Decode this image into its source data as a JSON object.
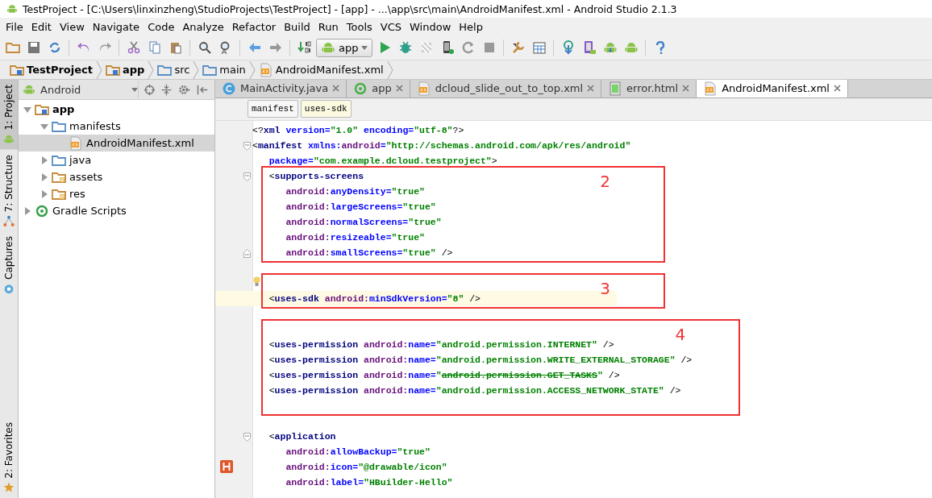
{
  "window": {
    "title": "TestProject - [C:\\Users\\linxinzheng\\StudioProjects\\TestProject] - [app] - ...\\app\\src\\main\\AndroidManifest.xml - Android Studio 2.1.3"
  },
  "menu": [
    "File",
    "Edit",
    "View",
    "Navigate",
    "Code",
    "Analyze",
    "Refactor",
    "Build",
    "Run",
    "Tools",
    "VCS",
    "Window",
    "Help"
  ],
  "toolbar": {
    "run_configuration": "app"
  },
  "nav_bar": [
    {
      "label": "TestProject",
      "kind": "project"
    },
    {
      "label": "app",
      "kind": "module"
    },
    {
      "label": "src",
      "kind": "folder"
    },
    {
      "label": "main",
      "kind": "folder"
    },
    {
      "label": "AndroidManifest.xml",
      "kind": "xml"
    }
  ],
  "side_tabs": [
    {
      "label": "1: Project",
      "kind": "android",
      "selected": true
    },
    {
      "label": "7: Structure",
      "kind": "structure",
      "selected": false
    },
    {
      "label": "Captures",
      "kind": "captures",
      "selected": false
    },
    {
      "label": "2: Favorites",
      "kind": "star",
      "selected": false
    }
  ],
  "project_panel": {
    "view_selector": "Android",
    "tree": [
      {
        "label": "app",
        "kind": "module",
        "expanded": true,
        "selected": false,
        "children": [
          {
            "label": "manifests",
            "kind": "folder",
            "expanded": true,
            "selected": false,
            "children": [
              {
                "label": "AndroidManifest.xml",
                "kind": "xml",
                "selected": true
              }
            ]
          },
          {
            "label": "java",
            "kind": "folder",
            "expanded": false,
            "selected": false
          },
          {
            "label": "assets",
            "kind": "resfolder",
            "expanded": false,
            "selected": false
          },
          {
            "label": "res",
            "kind": "resfolder",
            "expanded": false,
            "selected": false
          }
        ]
      },
      {
        "label": "Gradle Scripts",
        "kind": "gradle",
        "expanded": false,
        "selected": false
      }
    ]
  },
  "editor_tabs": [
    {
      "label": "MainActivity.java",
      "kind": "java",
      "selected": false
    },
    {
      "label": "app",
      "kind": "config",
      "selected": false
    },
    {
      "label": "dcloud_slide_out_to_top.xml",
      "kind": "xml",
      "selected": false
    },
    {
      "label": "error.html",
      "kind": "html",
      "selected": false
    },
    {
      "label": "AndroidManifest.xml",
      "kind": "xml",
      "selected": true
    }
  ],
  "breadcrumb_tags": [
    {
      "label": "manifest",
      "selected": false
    },
    {
      "label": "uses-sdk",
      "selected": true
    }
  ],
  "code_blocks": [
    {
      "lines": [
        {
          "current": false,
          "tokens": [
            {
              "text": "<?",
              "kind": "punct"
            },
            {
              "text": "xml",
              "kind": "tag"
            },
            {
              "text": " version=",
              "kind": "attr"
            },
            {
              "text": "\"1.0\"",
              "kind": "value"
            },
            {
              "text": " encoding=",
              "kind": "attr"
            },
            {
              "text": "\"utf-8\"",
              "kind": "value"
            },
            {
              "text": "?>",
              "kind": "punct"
            }
          ]
        },
        {
          "current": false,
          "gutter": {
            "kind": "fold-start"
          },
          "tokens": [
            {
              "text": "<",
              "kind": "punct"
            },
            {
              "text": "manifest",
              "kind": "tag"
            },
            {
              "text": " xmlns:",
              "kind": "attr"
            },
            {
              "text": "android",
              "kind": "ns"
            },
            {
              "text": "=",
              "kind": "attr"
            },
            {
              "text": "\"http://schemas.android.com/apk/res/android\"",
              "kind": "value"
            }
          ]
        },
        {
          "current": false,
          "tokens": [
            {
              "text": "   package=",
              "kind": "attr"
            },
            {
              "text": "\"com.example.dcloud.testproject\"",
              "kind": "value"
            },
            {
              "text": ">",
              "kind": "punct"
            }
          ]
        }
      ]
    },
    {
      "annotation": "2",
      "lines": [
        {
          "current": false,
          "gutter": {
            "kind": "fold-start"
          },
          "tokens": [
            {
              "text": "   <",
              "kind": "punct"
            },
            {
              "text": "supports-screens",
              "kind": "tag"
            }
          ]
        },
        {
          "current": false,
          "tokens": [
            {
              "text": "      android:",
              "kind": "ns"
            },
            {
              "text": "anyDensity=",
              "kind": "attr"
            },
            {
              "text": "\"true\"",
              "kind": "value"
            }
          ]
        },
        {
          "current": false,
          "tokens": [
            {
              "text": "      android:",
              "kind": "ns"
            },
            {
              "text": "largeScreens=",
              "kind": "attr"
            },
            {
              "text": "\"true\"",
              "kind": "value"
            }
          ]
        },
        {
          "current": false,
          "tokens": [
            {
              "text": "      android:",
              "kind": "ns"
            },
            {
              "text": "normalScreens=",
              "kind": "attr"
            },
            {
              "text": "\"true\"",
              "kind": "value"
            }
          ]
        },
        {
          "current": false,
          "tokens": [
            {
              "text": "      android:",
              "kind": "ns"
            },
            {
              "text": "resizeable=",
              "kind": "attr"
            },
            {
              "text": "\"true\"",
              "kind": "value"
            }
          ]
        },
        {
          "current": false,
          "gutter": {
            "kind": "fold-end"
          },
          "tokens": [
            {
              "text": "      android:",
              "kind": "ns"
            },
            {
              "text": "smallScreens=",
              "kind": "attr"
            },
            {
              "text": "\"true\"",
              "kind": "value"
            },
            {
              "text": " />",
              "kind": "punct"
            }
          ]
        }
      ]
    },
    {
      "lines": [
        {
          "current": false
        }
      ]
    },
    {
      "annotation": "3",
      "lines": [
        {
          "current": false,
          "gutter": {
            "kind": "bulb"
          }
        },
        {
          "current": true,
          "tokens": [
            {
              "text": "   <",
              "kind": "punct"
            },
            {
              "text": "uses-sdk",
              "kind": "tag"
            },
            {
              "text": " android:",
              "kind": "ns"
            },
            {
              "text": "minSdkVersion=",
              "kind": "attr"
            },
            {
              "text": "\"8\"",
              "kind": "value"
            },
            {
              "text": " />",
              "kind": "punct"
            }
          ]
        }
      ]
    },
    {
      "lines": [
        {
          "current": false
        }
      ]
    },
    {
      "annotation": "4",
      "lines": [
        {
          "current": false
        },
        {
          "current": false,
          "tokens": [
            {
              "text": "   <",
              "kind": "punct"
            },
            {
              "text": "uses-permission",
              "kind": "tag"
            },
            {
              "text": " android:",
              "kind": "ns"
            },
            {
              "text": "name=",
              "kind": "attr"
            },
            {
              "text": "\"android.permission.INTERNET\"",
              "kind": "value"
            },
            {
              "text": " />",
              "kind": "punct"
            }
          ]
        },
        {
          "current": false,
          "tokens": [
            {
              "text": "   <",
              "kind": "punct"
            },
            {
              "text": "uses-permission",
              "kind": "tag"
            },
            {
              "text": " android:",
              "kind": "ns"
            },
            {
              "text": "name=",
              "kind": "attr"
            },
            {
              "text": "\"android.permission.WRITE_EXTERNAL_STORAGE\"",
              "kind": "value"
            },
            {
              "text": " />",
              "kind": "punct"
            }
          ]
        },
        {
          "current": false,
          "tokens": [
            {
              "text": "   <",
              "kind": "punct"
            },
            {
              "text": "uses-permission",
              "kind": "tag"
            },
            {
              "text": " android:",
              "kind": "ns"
            },
            {
              "text": "name=",
              "kind": "attr"
            },
            {
              "text": "\"",
              "kind": "value"
            },
            {
              "text": "android.permission.GET_TASKS",
              "kind": "deprecated"
            },
            {
              "text": "\"",
              "kind": "value"
            },
            {
              "text": " />",
              "kind": "punct"
            }
          ]
        },
        {
          "current": false,
          "tokens": [
            {
              "text": "   <",
              "kind": "punct"
            },
            {
              "text": "uses-permission",
              "kind": "tag"
            },
            {
              "text": " android:",
              "kind": "ns"
            },
            {
              "text": "name=",
              "kind": "attr"
            },
            {
              "text": "\"android.permission.ACCESS_NETWORK_STATE\"",
              "kind": "value"
            },
            {
              "text": " />",
              "kind": "punct"
            }
          ]
        },
        {
          "current": false
        }
      ]
    },
    {
      "lines": [
        {
          "current": false
        },
        {
          "current": false,
          "gutter": {
            "kind": "fold-start"
          },
          "tokens": [
            {
              "text": "   <",
              "kind": "punct"
            },
            {
              "text": "application",
              "kind": "tag"
            }
          ]
        },
        {
          "current": false,
          "tokens": [
            {
              "text": "      android:",
              "kind": "ns"
            },
            {
              "text": "allowBackup=",
              "kind": "attr"
            },
            {
              "text": "\"true\"",
              "kind": "value"
            }
          ]
        },
        {
          "current": false,
          "gutter": {
            "kind": "html-marker"
          },
          "tokens": [
            {
              "text": "      android:",
              "kind": "ns"
            },
            {
              "text": "icon=",
              "kind": "attr"
            },
            {
              "text": "\"@drawable/icon\"",
              "kind": "value"
            }
          ]
        },
        {
          "current": false,
          "tokens": [
            {
              "text": "      android:",
              "kind": "ns"
            },
            {
              "text": "label=",
              "kind": "attr"
            },
            {
              "text": "\"HBuilder-Hello\"",
              "kind": "value"
            }
          ]
        }
      ]
    }
  ]
}
